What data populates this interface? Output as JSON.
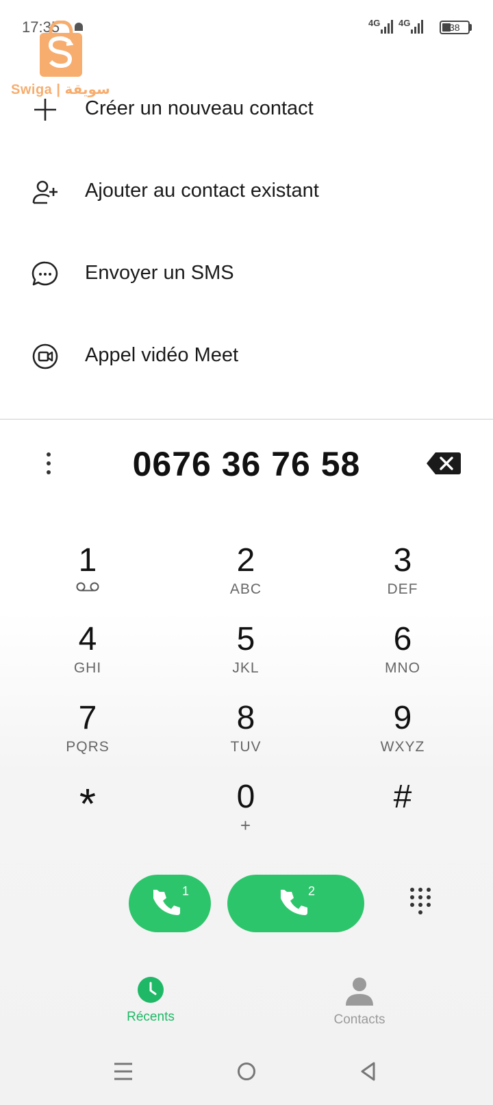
{
  "status_bar": {
    "time": "17:35",
    "network1": "4G",
    "network2": "4G",
    "battery": "38"
  },
  "watermark": {
    "text": "Swiga | سويقة",
    "color": "#f6ad6e"
  },
  "actions": [
    {
      "label": "Créer un nouveau contact",
      "icon": "plus-icon"
    },
    {
      "label": "Ajouter au contact existant",
      "icon": "add-person-icon"
    },
    {
      "label": "Envoyer un SMS",
      "icon": "message-icon"
    },
    {
      "label": "Appel vidéo Meet",
      "icon": "meet-video-icon"
    }
  ],
  "dialer": {
    "number": "0676 36 76 58",
    "keys": [
      {
        "digit": "1",
        "letters": ""
      },
      {
        "digit": "2",
        "letters": "ABC"
      },
      {
        "digit": "3",
        "letters": "DEF"
      },
      {
        "digit": "4",
        "letters": "GHI"
      },
      {
        "digit": "5",
        "letters": "JKL"
      },
      {
        "digit": "6",
        "letters": "MNO"
      },
      {
        "digit": "7",
        "letters": "PQRS"
      },
      {
        "digit": "8",
        "letters": "TUV"
      },
      {
        "digit": "9",
        "letters": "WXYZ"
      },
      {
        "digit": "*",
        "letters": ""
      },
      {
        "digit": "0",
        "letters": "+"
      },
      {
        "digit": "#",
        "letters": ""
      }
    ]
  },
  "call_buttons": [
    {
      "sim": "1"
    },
    {
      "sim": "2"
    }
  ],
  "bottom_nav": {
    "recents": "Récents",
    "contacts": "Contacts"
  },
  "colors": {
    "accent_green": "#2dc56b",
    "nav_active": "#1fb866",
    "nav_inactive": "#9a9a9a"
  }
}
